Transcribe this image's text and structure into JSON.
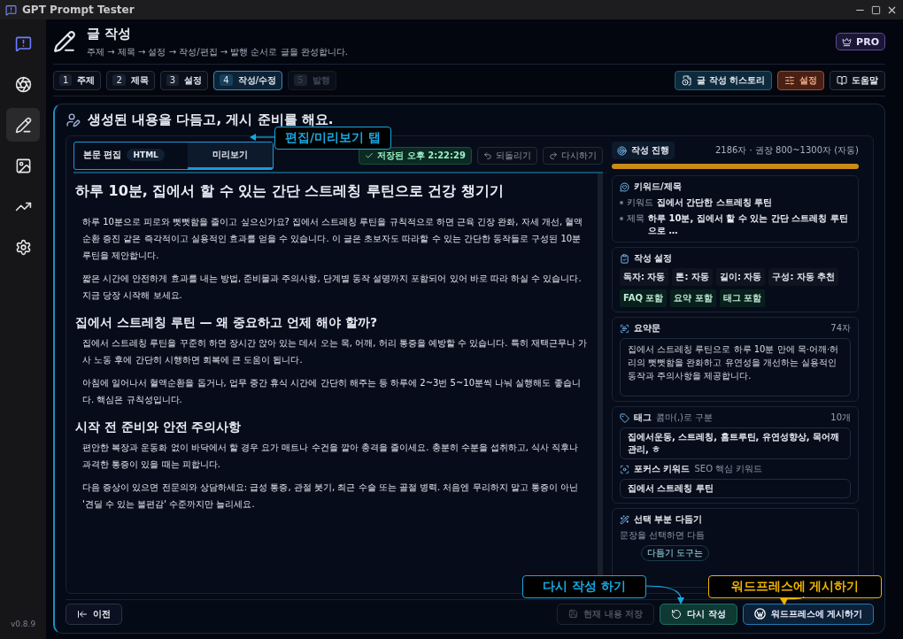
{
  "window": {
    "title": "GPT Prompt Tester"
  },
  "sidebar": {
    "items": [
      {
        "kind": "logo",
        "selected": false
      },
      {
        "kind": "aperture",
        "selected": false
      },
      {
        "kind": "pencil",
        "selected": true
      },
      {
        "kind": "image",
        "selected": false
      },
      {
        "kind": "chart",
        "selected": false
      },
      {
        "kind": "gear",
        "selected": false
      }
    ],
    "version": "v0.8.9"
  },
  "header": {
    "title": "글 작성",
    "subtitle": "주제 → 제목 → 설정 → 작성/편집 → 발행 순서로 글을 완성합니다.",
    "pro_button": "PRO"
  },
  "steps": [
    {
      "number": "1",
      "label": "주제",
      "selected": false,
      "disabled": false
    },
    {
      "number": "2",
      "label": "제목",
      "selected": false,
      "disabled": false
    },
    {
      "number": "3",
      "label": "설정",
      "selected": false,
      "disabled": false
    },
    {
      "number": "4",
      "label": "작성/수정",
      "selected": true,
      "disabled": false
    },
    {
      "number": "5",
      "label": "발행",
      "selected": false,
      "disabled": true
    }
  ],
  "toolbar": [
    {
      "kind": "history",
      "label": "글 작성 히스토리"
    },
    {
      "kind": "settings",
      "label": "설정"
    },
    {
      "kind": "help",
      "label": "도움말"
    }
  ],
  "card": {
    "heading": "생성된 내용을 다듬고, 게시 준비를 해요."
  },
  "editor": {
    "tabs": [
      {
        "label": "본문 편집",
        "badge": "HTML",
        "selected": false
      },
      {
        "label": "미리보기",
        "selected": true
      }
    ],
    "save_status": "저장된 오후 2:22:29",
    "undo": {
      "label": "되돌리기",
      "disabled": true
    },
    "redo": {
      "label": "다시하기",
      "disabled": true
    }
  },
  "article": [
    {
      "kind": "h1",
      "text": "하루 10분, 집에서 할 수 있는 간단 스트레칭 루틴으로 건강 챙기기"
    },
    {
      "kind": "p",
      "text": "하루 10분으로 피로와 뻣뻣함을 줄이고 싶으신가요? 집에서 스트레칭 루틴을 규칙적으로 하면 근육 긴장 완화, 자세 개선, 혈액순환 증진 같은 즉각적이고 실용적인 효과를 얻을 수 있습니다. 이 글은 초보자도 따라할 수 있는 간단한 동작들로 구성된 10분 루틴을 제안합니다."
    },
    {
      "kind": "p",
      "text": "짧은 시간에 안전하게 효과를 내는 방법, 준비물과 주의사항, 단계별 동작 설명까지 포함되어 있어 바로 따라 하실 수 있습니다. 지금 당장 시작해 보세요."
    },
    {
      "kind": "h2",
      "text": "집에서 스트레칭 루틴 — 왜 중요하고 언제 해야 할까?"
    },
    {
      "kind": "p",
      "text": "집에서 스트레칭 루틴을 꾸준히 하면 장시간 앉아 있는 데서 오는 목, 어깨, 허리 통증을 예방할 수 있습니다. 특히 재택근무나 가사 노동 후에 간단히 시행하면 회복에 큰 도움이 됩니다."
    },
    {
      "kind": "p",
      "text": "아침에 일어나서 혈액순환을 돕거나, 업무 중간 휴식 시간에 간단히 해주는 등 하루에 2~3번 5~10분씩 나눠 실행해도 좋습니다. 핵심은 규칙성입니다."
    },
    {
      "kind": "h2",
      "text": "시작 전 준비와 안전 주의사항"
    },
    {
      "kind": "p",
      "text": "편안한 복장과 운동화 없이 바닥에서 할 경우 요가 매트나 수건을 깔아 충격을 줄이세요. 충분히 수분을 섭취하고, 식사 직후나 과격한 통증이 있을 때는 피합니다."
    },
    {
      "kind": "p",
      "text": "다음 증상이 있으면 전문의와 상담하세요: 급성 통증, 관절 붓기, 최근 수술 또는 골절 병력. 처음엔 무리하지 말고 통증이 아닌 '견딜 수 있는 불편감' 수준까지만 늘리세요."
    }
  ],
  "progress": {
    "label": "작성 진행",
    "summary": "2186자 · 권장 800~1300자 (자동)",
    "level": 1
  },
  "keyword_title": {
    "heading": "키워드/제목",
    "rows": [
      {
        "label": "키워드",
        "value": "집에서 간단한 스트레칭 루틴"
      },
      {
        "label": "제목",
        "value": "하루 10분, 집에서 할 수 있는 간단 스트레칭 루틴으로 …"
      }
    ]
  },
  "write_settings": {
    "heading": "작성 설정",
    "chips": [
      {
        "kind": "setting",
        "text": "독자: 자동"
      },
      {
        "kind": "setting",
        "text": "톤: 자동"
      },
      {
        "kind": "setting",
        "text": "길이: 자동"
      },
      {
        "kind": "setting",
        "text": "구성: 자동 추천"
      },
      {
        "kind": "include",
        "text": "FAQ 포함"
      },
      {
        "kind": "include",
        "text": "요약 포함"
      },
      {
        "kind": "include",
        "text": "태그 포함"
      }
    ]
  },
  "summary": {
    "heading": "요약문",
    "count": "74자",
    "value": "집에서 스트레칭 루틴으로 하루 10분 만에 목·어깨·허리의 뻣뻣함을 완화하고 유연성을 개선하는 실용적인 동작과 주의사항을 제공합니다."
  },
  "tags": {
    "heading": "태그",
    "hint": "콤마(,)로 구분",
    "count": "10개",
    "value": "집에서운동, 스트레칭, 홈트루틴, 유연성향상, 목어깨관리, ㅎ"
  },
  "focus_keyword": {
    "heading": "포커스 키워드",
    "hint": "SEO 핵심 키워드",
    "value": "집에서 스트레칭 루틴"
  },
  "refine": {
    "heading": "선택 부분 다듬기",
    "hint": "문장을 선택하면 다듬",
    "pill": "다듬기 도구는"
  },
  "footer": {
    "prev": "이전",
    "save": {
      "label": "현재 내용 저장",
      "disabled": true
    },
    "rewrite": "다시 작성",
    "publish": "워드프레스에 게시하기"
  },
  "callouts": [
    {
      "text": "편집/미리보기 탭",
      "color": "#18a8e0"
    },
    {
      "text": "다시 작성 하기",
      "color": "#18a8e0"
    },
    {
      "text": "워드프레스에 게시하기",
      "color": "#f0b400"
    }
  ]
}
